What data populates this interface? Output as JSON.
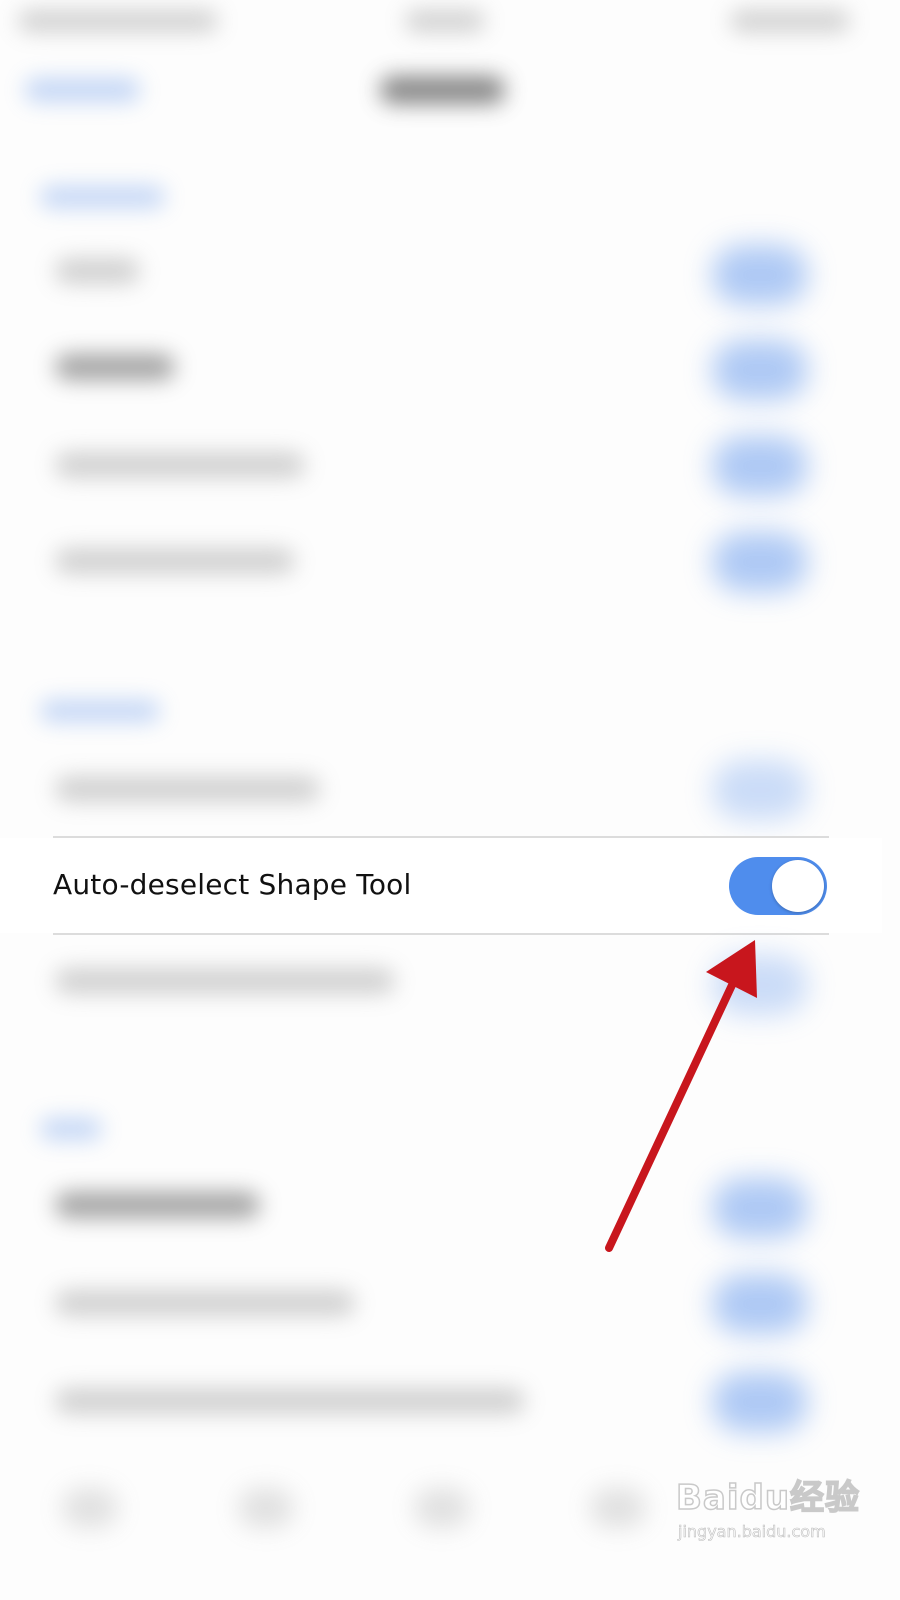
{
  "settings_row": {
    "label": "Auto-deselect Shape Tool",
    "toggle_on": true
  },
  "colors": {
    "accent": "#4f8ded",
    "arrow": "#c8161d",
    "divider": "#dcdcdc"
  },
  "watermark": {
    "logo": "Baidu经验",
    "url": "jingyan.baidu.com"
  }
}
